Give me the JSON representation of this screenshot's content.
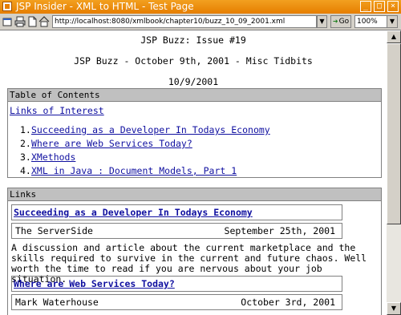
{
  "window": {
    "title": "JSP Insider - XML to HTML - Test Page",
    "buttons": {
      "minimize": "_",
      "maximize": "□",
      "close": "×"
    }
  },
  "toolbar": {
    "url": "http://localhost:8080/xmlbook/chapter10/buzz_10_09_2001.xml",
    "go_label": "Go",
    "zoom": "100%",
    "icons": [
      "new-window-icon",
      "print-icon",
      "page-icon",
      "home-icon"
    ]
  },
  "page": {
    "issue": "JSP Buzz: Issue #19",
    "subtitle": "JSP Buzz - October 9th, 2001 - Misc Tidbits",
    "date": "10/9/2001",
    "toc": {
      "heading": "Table of Contents",
      "links_label": "Links of Interest",
      "items": [
        {
          "num": "1.",
          "label": "Succeeding as a Developer In Todays Economy"
        },
        {
          "num": "2.",
          "label": "Where are Web Services Today?"
        },
        {
          "num": "3.",
          "label": "XMethods"
        },
        {
          "num": "4.",
          "label": "XML in Java : Document Models, Part 1"
        }
      ]
    },
    "links": {
      "heading": "Links",
      "entries": [
        {
          "title": "Succeeding as a Developer In Todays Economy",
          "source": "The ServerSide",
          "date": "September 25th, 2001",
          "description": "A discussion and article about the current marketplace and the skills required to survive in the current and future chaos. Well worth the time to read if you are nervous about your job situation."
        },
        {
          "title": "Where are Web Services Today?",
          "source": "Mark Waterhouse",
          "date": "October 3rd, 2001"
        }
      ]
    }
  },
  "colors": {
    "titlebar": "#e67e00",
    "link": "#1010a0",
    "section_bar": "#c0c0c0"
  }
}
